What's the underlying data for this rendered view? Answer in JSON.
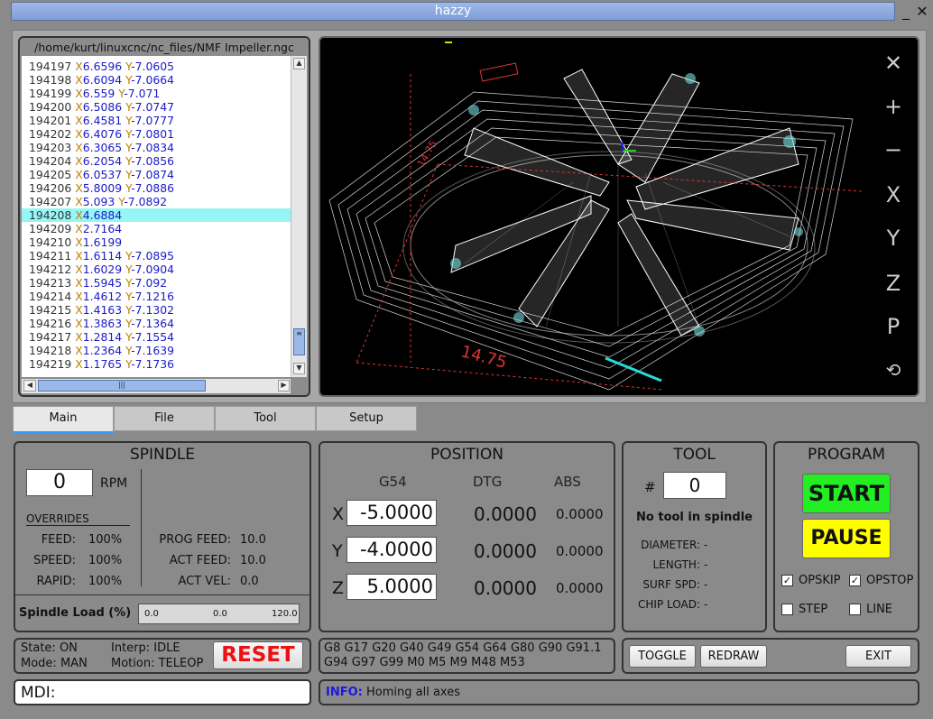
{
  "window": {
    "title": "hazzy",
    "minimize": "_",
    "close": "✕"
  },
  "gcode": {
    "file_path": "/home/kurt/linuxcnc/nc_files/NMF Impeller.ngc",
    "lines": [
      {
        "n": "194197",
        "x": "6.6596",
        "y": "-7.0605"
      },
      {
        "n": "194198",
        "x": "6.6094",
        "y": "-7.0664"
      },
      {
        "n": "194199",
        "x": "6.559",
        "y": "-7.071"
      },
      {
        "n": "194200",
        "x": "6.5086",
        "y": "-7.0747"
      },
      {
        "n": "194201",
        "x": "6.4581",
        "y": "-7.0777"
      },
      {
        "n": "194202",
        "x": "6.4076",
        "y": "-7.0801"
      },
      {
        "n": "194203",
        "x": "6.3065",
        "y": "-7.0834"
      },
      {
        "n": "194204",
        "x": "6.2054",
        "y": "-7.0856"
      },
      {
        "n": "194205",
        "x": "6.0537",
        "y": "-7.0874"
      },
      {
        "n": "194206",
        "x": "5.8009",
        "y": "-7.0886"
      },
      {
        "n": "194207",
        "x": "5.093",
        "y": "-7.0892"
      },
      {
        "n": "194208",
        "x": "4.6884",
        "y": ""
      },
      {
        "n": "194209",
        "x": "2.7164",
        "y": ""
      },
      {
        "n": "194210",
        "x": "1.6199",
        "y": ""
      },
      {
        "n": "194211",
        "x": "1.6114",
        "y": "-7.0895"
      },
      {
        "n": "194212",
        "x": "1.6029",
        "y": "-7.0904"
      },
      {
        "n": "194213",
        "x": "1.5945",
        "y": "-7.092"
      },
      {
        "n": "194214",
        "x": "1.4612",
        "y": "-7.1216"
      },
      {
        "n": "194215",
        "x": "1.4163",
        "y": "-7.1302"
      },
      {
        "n": "194216",
        "x": "1.3863",
        "y": "-7.1364"
      },
      {
        "n": "194217",
        "x": "1.2814",
        "y": "-7.1554"
      },
      {
        "n": "194218",
        "x": "1.2364",
        "y": "-7.1639"
      },
      {
        "n": "194219",
        "x": "1.1765",
        "y": "-7.1736"
      }
    ],
    "selected_line": "194208"
  },
  "viewer": {
    "buttons": {
      "tools": "tools-icon",
      "zoom_in": "+",
      "zoom_out": "−",
      "x": "X",
      "y": "Y",
      "z": "Z",
      "p": "P",
      "rotate": "rotate-icon"
    },
    "dimension_label": "14.75",
    "side_label": "14.75"
  },
  "tabs": [
    {
      "label": "Main",
      "active": true
    },
    {
      "label": "File",
      "active": false
    },
    {
      "label": "Tool",
      "active": false
    },
    {
      "label": "Setup",
      "active": false
    }
  ],
  "spindle": {
    "title": "SPINDLE",
    "rpm": "0",
    "rpm_unit": "RPM",
    "overrides_label": "OVERRIDES",
    "feed_label": "FEED:",
    "feed": "100%",
    "speed_label": "SPEED:",
    "speed": "100%",
    "rapid_label": "RAPID:",
    "rapid": "100%",
    "prog_feed_label": "PROG FEED:",
    "prog_feed": "10.0",
    "act_feed_label": "ACT FEED:",
    "act_feed": "10.0",
    "act_vel_label": "ACT VEL:",
    "act_vel": "0.0",
    "load_label": "Spindle Load (%)",
    "load_min": "0.0",
    "load_value": "0.0",
    "load_max": "120.0"
  },
  "position": {
    "title": "POSITION",
    "col_g54": "G54",
    "col_dtg": "DTG",
    "col_abs": "ABS",
    "axes": [
      {
        "axis": "X",
        "g54": "-5.0000",
        "dtg": "0.0000",
        "abs": "0.0000"
      },
      {
        "axis": "Y",
        "g54": "-4.0000",
        "dtg": "0.0000",
        "abs": "0.0000"
      },
      {
        "axis": "Z",
        "g54": "5.0000",
        "dtg": "0.0000",
        "abs": "0.0000"
      }
    ]
  },
  "tool": {
    "title": "TOOL",
    "hash": "#",
    "number": "0",
    "status": "No tool in spindle",
    "diameter_label": "DIAMETER:",
    "diameter": "-",
    "length_label": "LENGTH:",
    "length": "-",
    "surf_spd_label": "SURF SPD:",
    "surf_spd": "-",
    "chip_load_label": "CHIP LOAD:",
    "chip_load": "-"
  },
  "program": {
    "title": "PROGRAM",
    "start": "START",
    "pause": "PAUSE",
    "opskip_label": "OPSKIP",
    "opskip": true,
    "opstop_label": "OPSTOP",
    "opstop": true,
    "step_label": "STEP",
    "step": false,
    "line_label": "LINE",
    "line": false,
    "start_color": "#22ee22",
    "pause_color": "#ffff00"
  },
  "status": {
    "state_label": "State:",
    "state": "ON",
    "mode_label": "Mode:",
    "mode": "MAN",
    "interp_label": "Interp:",
    "interp": "IDLE",
    "motion_label": "Motion:",
    "motion": "TELEOP",
    "reset": "RESET",
    "reset_color": "#ee1111"
  },
  "gcodes": {
    "line1": "G8 G17 G20 G40 G49 G54 G64 G80 G90 G91.1",
    "line2": "G94 G97 G99 M0 M5 M9 M48 M53"
  },
  "controls": {
    "toggle": "TOGGLE",
    "redraw": "REDRAW",
    "exit": "EXIT"
  },
  "mdi": {
    "label": "MDI:",
    "value": ""
  },
  "message": {
    "prefix": "INFO:",
    "text": "Homing all axes"
  }
}
